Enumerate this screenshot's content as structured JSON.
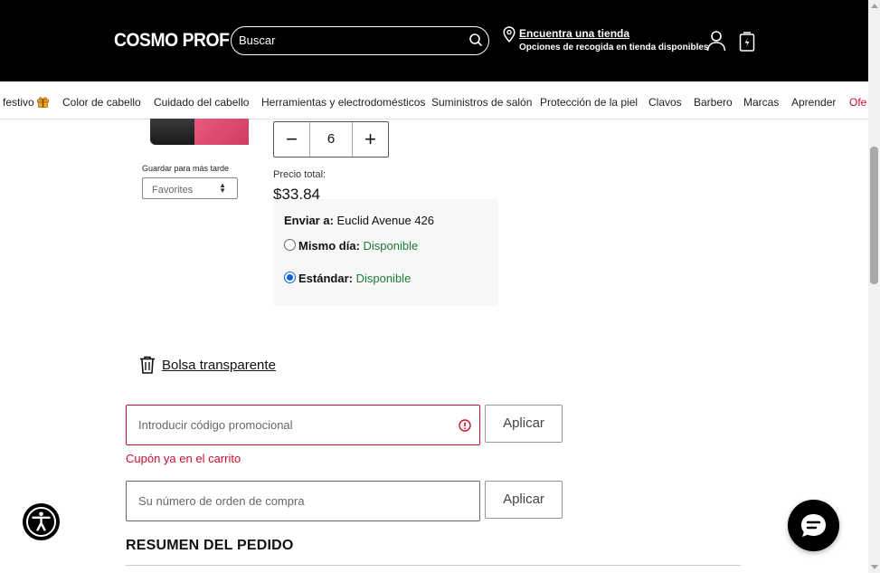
{
  "header": {
    "logo": "COSMO PROF",
    "search_placeholder": "Buscar",
    "store_link": "Encuentra una tienda",
    "store_sub": "Opciones de recogida en tienda disponibles"
  },
  "nav": {
    "items": [
      "festivo",
      "Color de cabello",
      "Cuidado del cabello",
      "Herramientas y electrodomésticos",
      "Suministros de salón",
      "Protección de la piel",
      "Clavos",
      "Barbero",
      "Marcas",
      "Aprender",
      "Ofe"
    ]
  },
  "product": {
    "save_label": "Guardar para más tarde",
    "favorites_value": "Favorites",
    "quantity": "6",
    "total_label": "Precio total:",
    "total_price": "$33.84"
  },
  "shipping": {
    "ship_to_label": "Enviar a:",
    "ship_to_value": "Euclid Avenue 426",
    "options": [
      {
        "name": "Mismo día:",
        "status": "Disponible",
        "selected": false
      },
      {
        "name": "Estándar:",
        "status": "Disponible",
        "selected": true
      }
    ]
  },
  "bag": {
    "label": "Bolsa transparente"
  },
  "promo": {
    "placeholder": "Introducir código promocional",
    "apply_label": "Aplicar",
    "error": "Cupón ya en el carrito"
  },
  "po": {
    "placeholder": "Su número de orden de compra",
    "apply_label": "Aplicar"
  },
  "summary": {
    "title": "RESUMEN DEL PEDIDO"
  },
  "colors": {
    "accent_red": "#c8102e",
    "available_green": "#1e7d34",
    "radio_blue": "#0a63d8"
  },
  "icons": [
    "search-icon",
    "location-pin-icon",
    "account-icon",
    "cart-icon",
    "gift-icon",
    "minus-icon",
    "plus-icon",
    "trash-icon",
    "warning-icon",
    "accessibility-icon",
    "chat-icon"
  ]
}
